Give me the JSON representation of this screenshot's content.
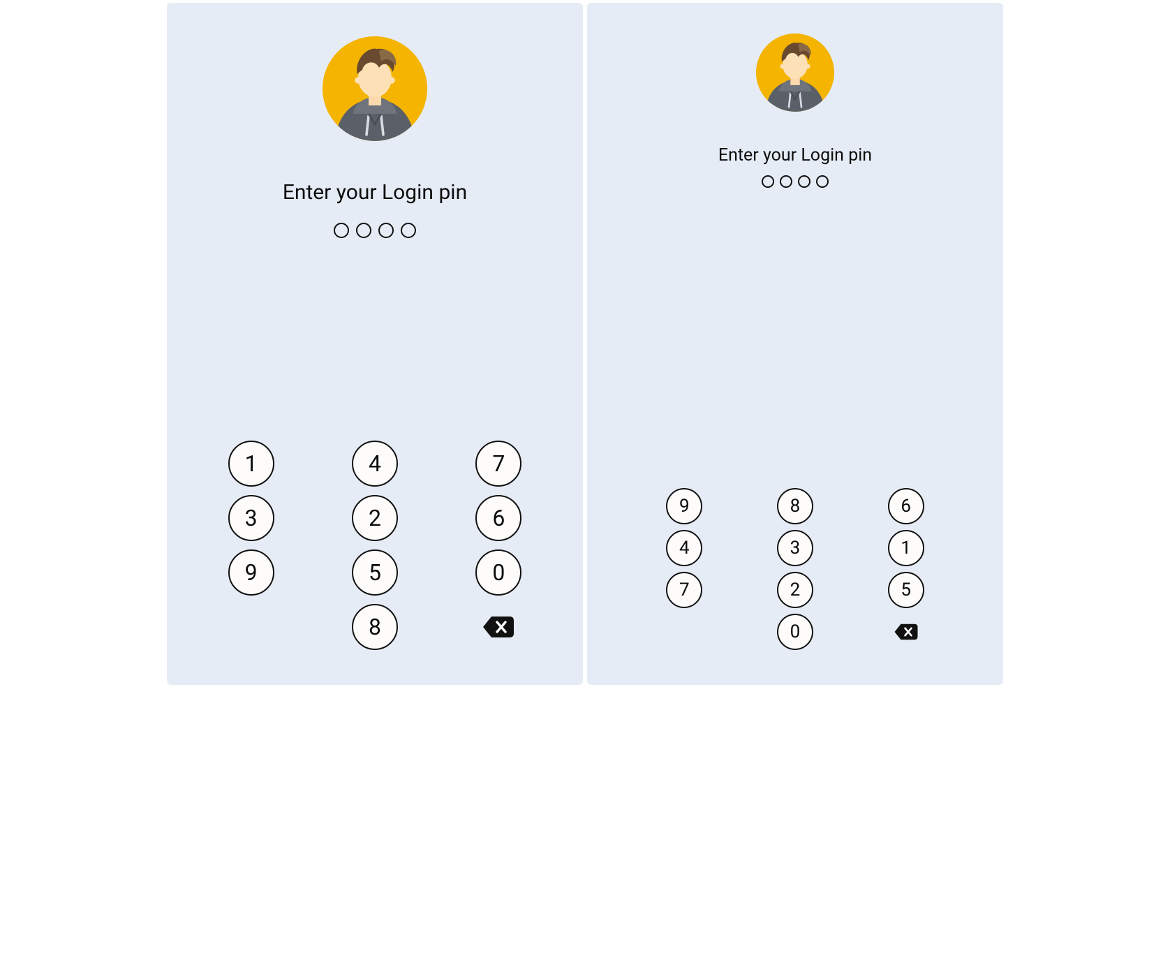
{
  "screens": [
    {
      "title": "Enter your Login pin",
      "pin_length": 4,
      "pin_filled": 0,
      "avatar_size": "large",
      "keypad": {
        "cols": [
          [
            "1",
            "3",
            "9"
          ],
          [
            "4",
            "2",
            "5",
            "8"
          ],
          [
            "7",
            "6",
            "0"
          ]
        ],
        "backspace_col": 2
      }
    },
    {
      "title": "Enter your Login pin",
      "pin_length": 4,
      "pin_filled": 0,
      "avatar_size": "small",
      "keypad": {
        "cols": [
          [
            "9",
            "4",
            "7"
          ],
          [
            "8",
            "3",
            "2",
            "0"
          ],
          [
            "6",
            "1",
            "5"
          ]
        ],
        "backspace_col": 2
      }
    }
  ]
}
